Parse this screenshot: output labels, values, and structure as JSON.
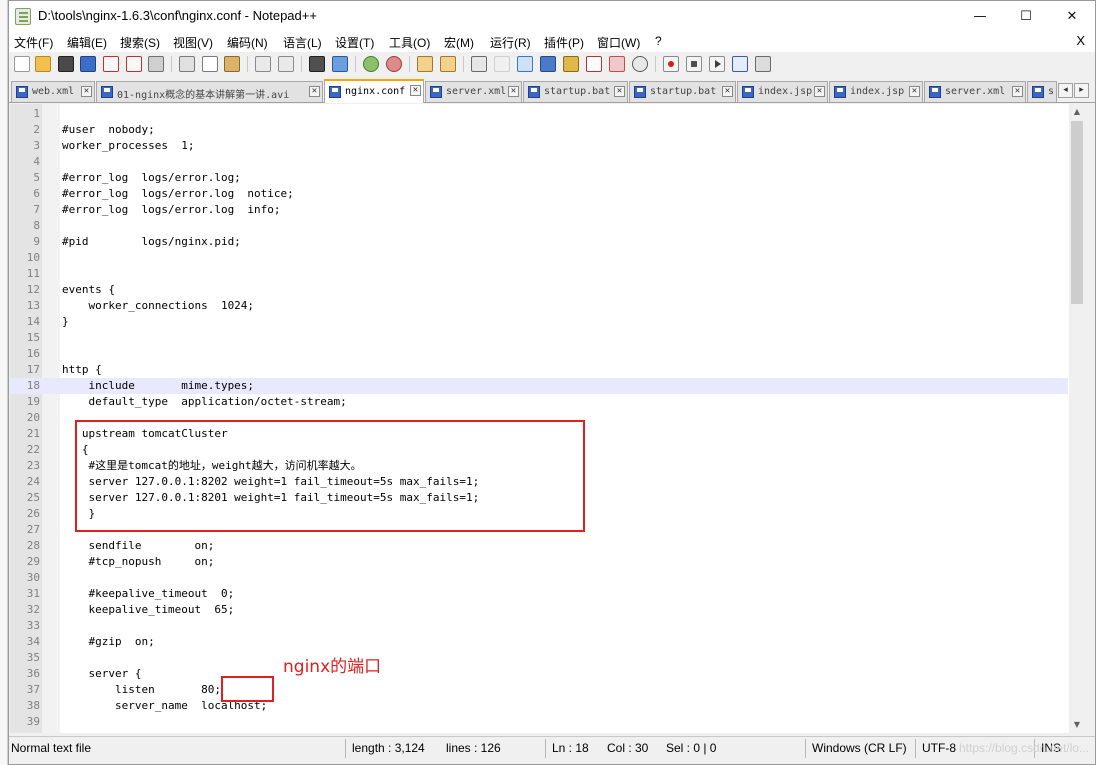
{
  "window": {
    "title": "D:\\tools\\nginx-1.6.3\\conf\\nginx.conf - Notepad++",
    "minimize_glyph": "—",
    "maximize_glyph": "☐",
    "close_glyph": "✕"
  },
  "menu": {
    "items": [
      "文件(F)",
      "编辑(E)",
      "搜索(S)",
      "视图(V)",
      "编码(N)",
      "语言(L)",
      "设置(T)",
      "工具(O)",
      "宏(M)",
      "运行(R)",
      "插件(P)",
      "窗口(W)",
      "?"
    ],
    "close_label": "X"
  },
  "toolbar": {
    "icons": [
      "new-file-icon",
      "open-file-icon",
      "save-icon",
      "save-all-icon",
      "close-icon",
      "close-all-icon",
      "print-icon",
      "cut-icon",
      "copy-icon",
      "paste-icon",
      "undo-icon",
      "redo-icon",
      "find-icon",
      "replace-icon",
      "zoom-in-icon",
      "zoom-out-icon",
      "sync-vertical-icon",
      "sync-horizontal-icon",
      "word-wrap-icon",
      "show-all-chars-icon",
      "indent-guide-icon",
      "document-map-icon",
      "function-list-icon",
      "folder-workspace-icon",
      "monitoring-icon",
      "record-macro-icon",
      "stop-record-icon",
      "playback-macro-icon",
      "run-macro-multiple-icon",
      "save-macro-icon"
    ]
  },
  "tabs": [
    {
      "label": "web.xml",
      "active": false
    },
    {
      "label": "01-nginx概念的基本讲解第一讲.avi",
      "active": false
    },
    {
      "label": "nginx.conf",
      "active": true
    },
    {
      "label": "server.xml",
      "active": false
    },
    {
      "label": "startup.bat",
      "active": false
    },
    {
      "label": "startup.bat",
      "active": false
    },
    {
      "label": "index.jsp",
      "active": false
    },
    {
      "label": "index.jsp",
      "active": false
    },
    {
      "label": "server.xml",
      "active": false
    },
    {
      "label": "s",
      "active": false
    }
  ],
  "tab_scroll": {
    "left": "◂",
    "right": "▸"
  },
  "editor": {
    "current_line": 18,
    "lines": [
      {
        "n": "1",
        "text": ""
      },
      {
        "n": "2",
        "text": "#user  nobody;"
      },
      {
        "n": "3",
        "text": "worker_processes  1;"
      },
      {
        "n": "4",
        "text": ""
      },
      {
        "n": "5",
        "text": "#error_log  logs/error.log;"
      },
      {
        "n": "6",
        "text": "#error_log  logs/error.log  notice;"
      },
      {
        "n": "7",
        "text": "#error_log  logs/error.log  info;"
      },
      {
        "n": "8",
        "text": ""
      },
      {
        "n": "9",
        "text": "#pid        logs/nginx.pid;"
      },
      {
        "n": "10",
        "text": ""
      },
      {
        "n": "11",
        "text": ""
      },
      {
        "n": "12",
        "text": "events {"
      },
      {
        "n": "13",
        "text": "    worker_connections  1024;"
      },
      {
        "n": "14",
        "text": "}"
      },
      {
        "n": "15",
        "text": ""
      },
      {
        "n": "16",
        "text": ""
      },
      {
        "n": "17",
        "text": "http {"
      },
      {
        "n": "18",
        "text": "    include       mime.types;"
      },
      {
        "n": "19",
        "text": "    default_type  application/octet-stream;"
      },
      {
        "n": "20",
        "text": ""
      },
      {
        "n": "21",
        "text": "   upstream tomcatCluster"
      },
      {
        "n": "22",
        "text": "   {"
      },
      {
        "n": "23",
        "text": "    #这里是tomcat的地址，weight越大，访问机率越大。"
      },
      {
        "n": "24",
        "text": "    server 127.0.0.1:8202 weight=1 fail_timeout=5s max_fails=1;"
      },
      {
        "n": "25",
        "text": "    server 127.0.0.1:8201 weight=1 fail_timeout=5s max_fails=1;"
      },
      {
        "n": "26",
        "text": "    }"
      },
      {
        "n": "27",
        "text": ""
      },
      {
        "n": "28",
        "text": "    sendfile        on;"
      },
      {
        "n": "29",
        "text": "    #tcp_nopush     on;"
      },
      {
        "n": "30",
        "text": ""
      },
      {
        "n": "31",
        "text": "    #keepalive_timeout  0;"
      },
      {
        "n": "32",
        "text": "    keepalive_timeout  65;"
      },
      {
        "n": "33",
        "text": ""
      },
      {
        "n": "34",
        "text": "    #gzip  on;"
      },
      {
        "n": "35",
        "text": ""
      },
      {
        "n": "36",
        "text": "    server {"
      },
      {
        "n": "37",
        "text": "        listen       80;"
      },
      {
        "n": "38",
        "text": "        server_name  localhost;"
      },
      {
        "n": "39",
        "text": ""
      }
    ],
    "annotation": "nginx的端口"
  },
  "scrollbar": {
    "up": "▲",
    "down": "▼"
  },
  "status": {
    "file_type": "Normal text file",
    "length": "length : 3,124",
    "lines": "lines : 126",
    "ln": "Ln : 18",
    "col": "Col : 30",
    "sel": "Sel : 0 | 0",
    "eol": "Windows (CR LF)",
    "encoding": "UTF-8",
    "mode": "INS",
    "watermark": "https://blog.csdn.net/lo..."
  },
  "colors": {
    "annotation_red": "#e02020",
    "current_line": "#e8e8ff",
    "active_tab_accent": "#f6a500"
  }
}
